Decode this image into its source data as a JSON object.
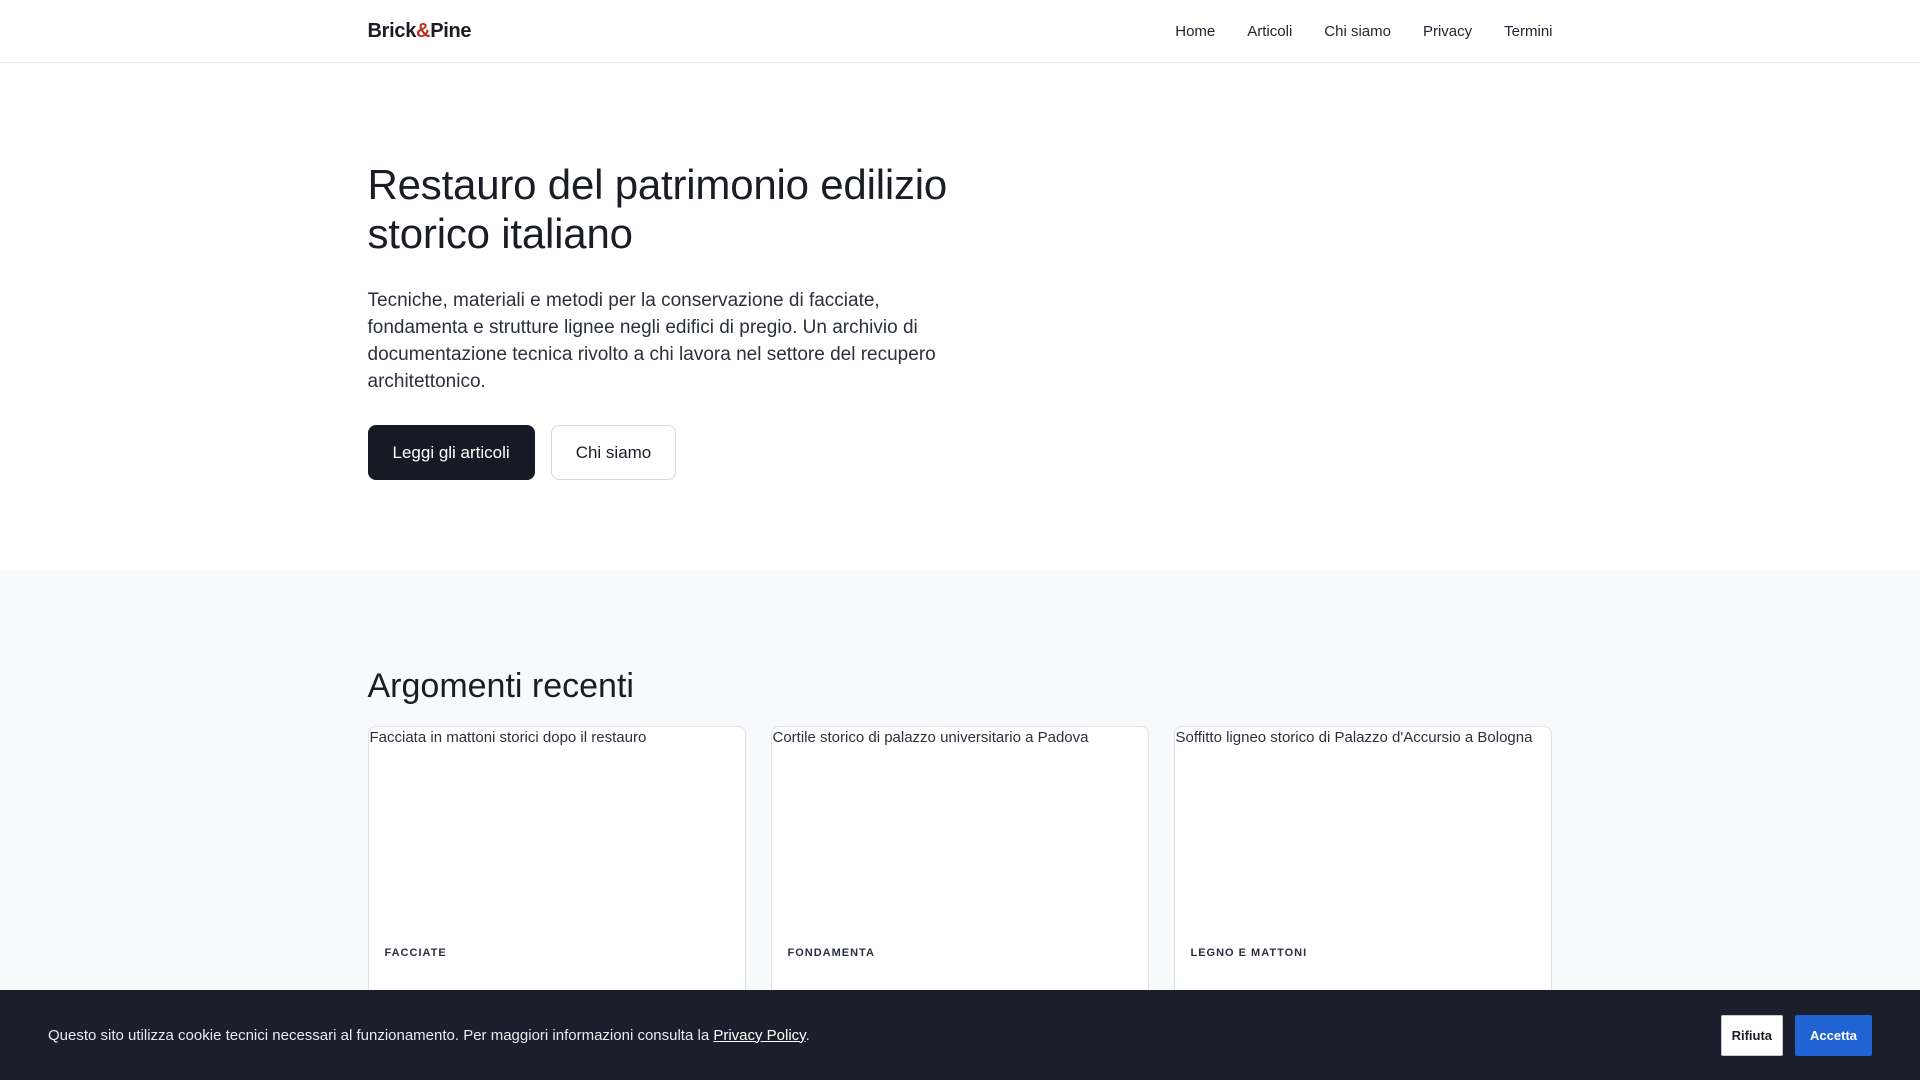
{
  "header": {
    "logo_part1": "Brick",
    "logo_amp": "&",
    "logo_part2": "Pine",
    "nav": [
      "Home",
      "Articoli",
      "Chi siamo",
      "Privacy",
      "Termini"
    ]
  },
  "hero": {
    "title": "Restauro del patrimonio edilizio storico italiano",
    "description": "Tecniche, materiali e metodi per la conservazione di facciate, fondamenta e strutture lignee negli edifici di pregio. Un archivio di documentazione tecnica rivolto a chi lavora nel settore del recupero architettonico.",
    "primary_button": "Leggi gli articoli",
    "secondary_button": "Chi siamo"
  },
  "topics": {
    "heading": "Argomenti recenti",
    "cards": [
      {
        "image_alt": "Facciata in mattoni storici dopo il restauro",
        "tag": "FACCIATE"
      },
      {
        "image_alt": "Cortile storico di palazzo universitario a Padova",
        "tag": "FONDAMENTA"
      },
      {
        "image_alt": "Soffitto ligneo storico di Palazzo d'Accursio a Bologna",
        "tag": "LEGNO E MATTONI"
      }
    ]
  },
  "cookie": {
    "text": "Questo sito utilizza cookie tecnici necessari al funzionamento. Per maggiori informazioni consulta la ",
    "link": "Privacy Policy",
    "period": ".",
    "reject": "Rifiuta",
    "accept": "Accetta"
  },
  "colors": {
    "accent_amp": "#b5321e",
    "primary_button": "#161a24",
    "accept_button": "#1f63d4",
    "cookie_bar": "#1b1f2b"
  }
}
